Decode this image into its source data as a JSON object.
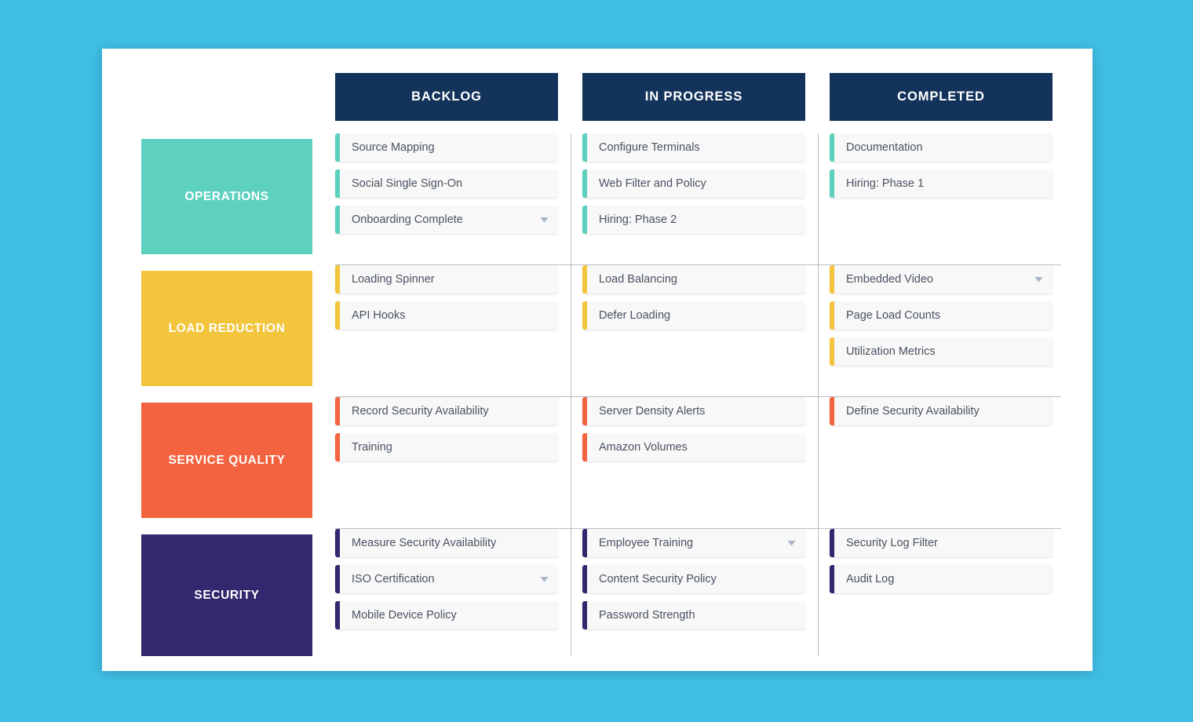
{
  "theme": {
    "background": "#3fbee4",
    "panel": "#ffffff",
    "header_navy": "#14335a",
    "divider": "#b9bdc4",
    "card_background": "#f8f8f8",
    "card_text": "#4a5361",
    "chevron": "#a9b6c4"
  },
  "columns": [
    {
      "label": "BACKLOG"
    },
    {
      "label": "IN PROGRESS"
    },
    {
      "label": "COMPLETED"
    }
  ],
  "lanes": [
    {
      "label": "OPERATIONS",
      "color": "#5ed0c0",
      "accent": "accent-teal",
      "cards": [
        [
          {
            "label": "Source Mapping",
            "chevron": false
          },
          {
            "label": "Social Single Sign-On",
            "chevron": false
          },
          {
            "label": "Onboarding Complete",
            "chevron": true
          }
        ],
        [
          {
            "label": "Configure Terminals",
            "chevron": false
          },
          {
            "label": "Web Filter and Policy",
            "chevron": false
          },
          {
            "label": "Hiring: Phase 2",
            "chevron": false
          }
        ],
        [
          {
            "label": "Documentation",
            "chevron": false
          },
          {
            "label": "Hiring: Phase 1",
            "chevron": false
          }
        ]
      ]
    },
    {
      "label": "LOAD REDUCTION",
      "color": "#f2c53d",
      "accent": "accent-yellow",
      "cards": [
        [
          {
            "label": "Loading Spinner",
            "chevron": false
          },
          {
            "label": "API Hooks",
            "chevron": false
          }
        ],
        [
          {
            "label": "Load Balancing",
            "chevron": false
          },
          {
            "label": "Defer Loading",
            "chevron": false
          }
        ],
        [
          {
            "label": "Embedded Video",
            "chevron": true
          },
          {
            "label": "Page Load Counts",
            "chevron": false
          },
          {
            "label": "Utilization Metrics",
            "chevron": false
          }
        ]
      ]
    },
    {
      "label": "SERVICE QUALITY",
      "color": "#f4633f",
      "accent": "accent-coral",
      "cards": [
        [
          {
            "label": "Record Security Availability",
            "chevron": false
          },
          {
            "label": "Training",
            "chevron": false
          }
        ],
        [
          {
            "label": "Server Density Alerts",
            "chevron": false
          },
          {
            "label": "Amazon Volumes",
            "chevron": false
          }
        ],
        [
          {
            "label": "Define Security Availability",
            "chevron": false
          }
        ]
      ]
    },
    {
      "label": "SECURITY",
      "color": "#33276e",
      "accent": "accent-indigo",
      "cards": [
        [
          {
            "label": "Measure Security Availability",
            "chevron": false
          },
          {
            "label": "ISO Certification",
            "chevron": true
          },
          {
            "label": "Mobile Device Policy",
            "chevron": false
          }
        ],
        [
          {
            "label": "Employee Training",
            "chevron": true
          },
          {
            "label": "Content Security Policy",
            "chevron": false
          },
          {
            "label": "Password Strength",
            "chevron": false
          }
        ],
        [
          {
            "label": "Security Log Filter",
            "chevron": false
          },
          {
            "label": "Audit Log",
            "chevron": false
          }
        ]
      ]
    }
  ]
}
